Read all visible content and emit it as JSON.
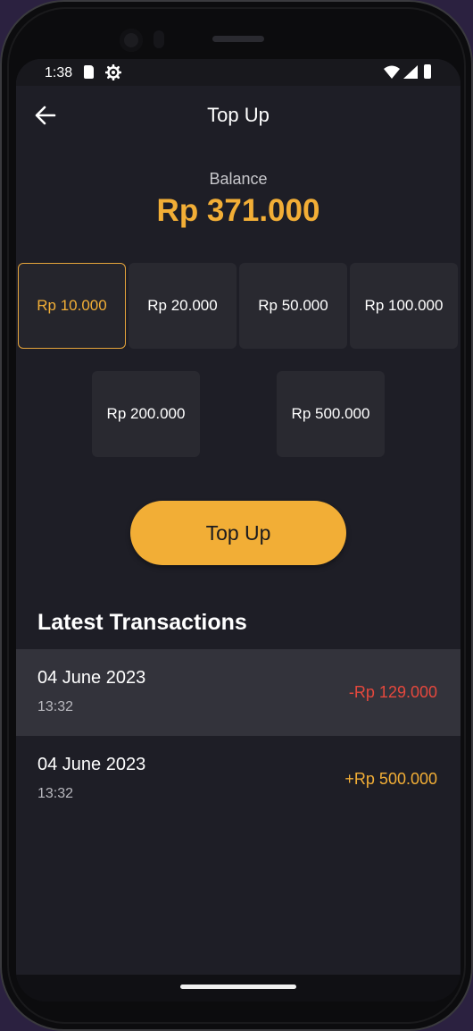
{
  "status_bar": {
    "time": "1:38"
  },
  "app_bar": {
    "title": "Top Up"
  },
  "balance": {
    "label": "Balance",
    "value": "Rp 371.000"
  },
  "amounts": [
    {
      "label": "Rp 10.000",
      "selected": true
    },
    {
      "label": "Rp 20.000",
      "selected": false
    },
    {
      "label": "Rp 50.000",
      "selected": false
    },
    {
      "label": "Rp 100.000",
      "selected": false
    },
    {
      "label": "Rp 200.000",
      "selected": false
    },
    {
      "label": "Rp 500.000",
      "selected": false
    }
  ],
  "topup_button": {
    "label": "Top Up"
  },
  "transactions": {
    "title": "Latest Transactions",
    "items": [
      {
        "date": "04 June 2023",
        "time": "13:32",
        "amount": "-Rp 129.000",
        "color": "#e5483d"
      },
      {
        "date": "04 June 2023",
        "time": "13:32",
        "amount": "+Rp 500.000",
        "color": "#f2ae36"
      }
    ]
  },
  "colors": {
    "accent": "#f2ae36",
    "negative": "#e5483d",
    "background": "#1e1e26",
    "card": "#292930"
  }
}
